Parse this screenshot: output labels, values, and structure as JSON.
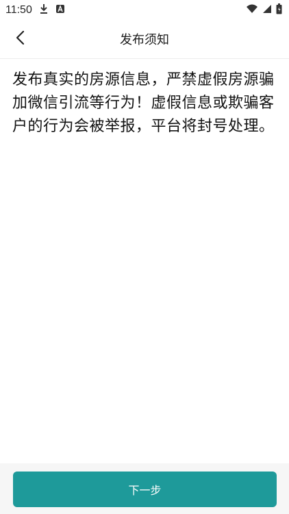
{
  "status_bar": {
    "time": "11:50",
    "icons": [
      "download-icon",
      "android-icon",
      "wifi-icon",
      "signal-icon",
      "battery-icon"
    ]
  },
  "nav": {
    "title": "发布须知",
    "back_icon": "chevron-left-icon"
  },
  "notice": {
    "text": "发布真实的房源信息，严禁虚假房源骗加微信引流等行为！虚假信息或欺骗客户的行为会被举报，平台将封号处理。"
  },
  "footer": {
    "next_label": "下一步",
    "button_color": "#1e9a9a"
  }
}
